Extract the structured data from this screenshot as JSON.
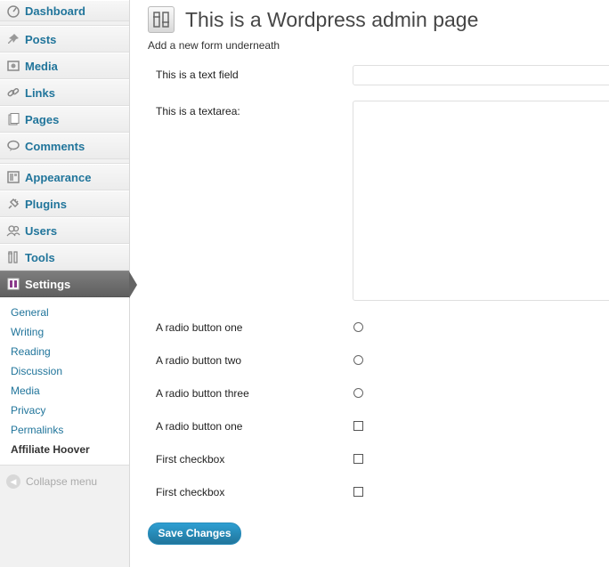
{
  "sidebar": {
    "items": [
      {
        "label": "Dashboard",
        "icon": "dashboard-icon"
      },
      {
        "label": "Posts",
        "icon": "pin-icon"
      },
      {
        "label": "Media",
        "icon": "media-icon"
      },
      {
        "label": "Links",
        "icon": "link-icon"
      },
      {
        "label": "Pages",
        "icon": "pages-icon"
      },
      {
        "label": "Comments",
        "icon": "comment-icon"
      },
      {
        "label": "Appearance",
        "icon": "appearance-icon"
      },
      {
        "label": "Plugins",
        "icon": "plugin-icon"
      },
      {
        "label": "Users",
        "icon": "users-icon"
      },
      {
        "label": "Tools",
        "icon": "tools-icon"
      },
      {
        "label": "Settings",
        "icon": "settings-icon"
      }
    ],
    "submenu": [
      "General",
      "Writing",
      "Reading",
      "Discussion",
      "Media",
      "Privacy",
      "Permalinks",
      "Affiliate Hoover"
    ],
    "collapse_label": "Collapse menu",
    "accent_color": "#21759b"
  },
  "main": {
    "title": "This is a Wordpress admin page",
    "subtitle": "Add a new form underneath",
    "fields": {
      "text_label": "This is a text field",
      "textarea_label": "This is a textarea:",
      "radio1_label": "A radio button one",
      "radio2_label": "A radio button two",
      "radio3_label": "A radio button three",
      "radio4_label": "A radio button one",
      "checkbox1_label": "First checkbox",
      "checkbox2_label": "First checkbox"
    },
    "save_label": "Save Changes"
  }
}
